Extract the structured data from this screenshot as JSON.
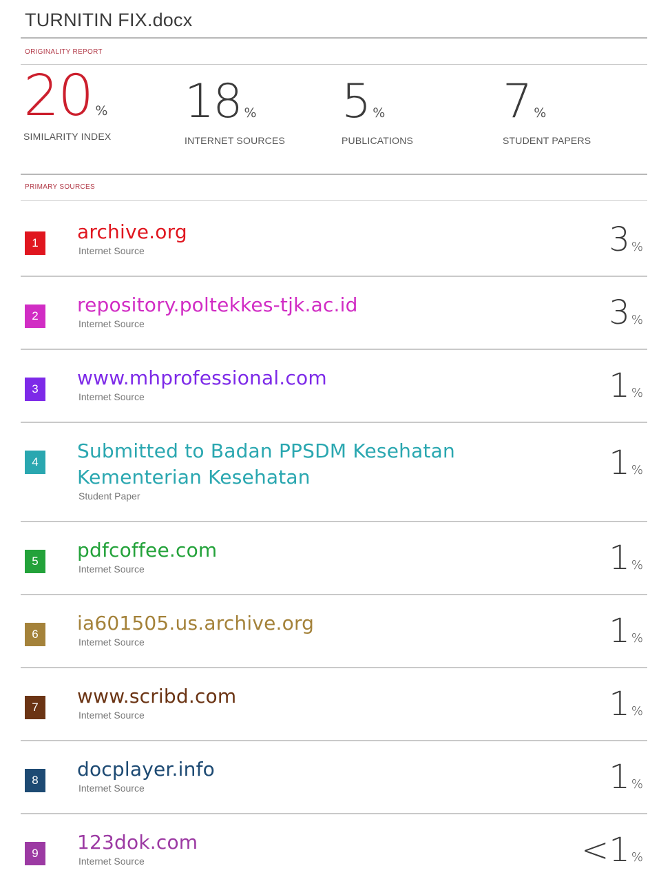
{
  "document": {
    "title": "TURNITIN FIX.docx"
  },
  "originality": {
    "label": "ORIGINALITY REPORT",
    "metrics": [
      {
        "value": "20",
        "unit": "%",
        "label": "SIMILARITY INDEX"
      },
      {
        "value": "18",
        "unit": "%",
        "label": "INTERNET SOURCES"
      },
      {
        "value": "5",
        "unit": "%",
        "label": "PUBLICATIONS"
      },
      {
        "value": "7",
        "unit": "%",
        "label": "STUDENT PAPERS"
      }
    ]
  },
  "primary_sources": {
    "label": "PRIMARY SOURCES",
    "items": [
      {
        "rank": "1",
        "name_lines": [
          "archive.org"
        ],
        "type": "Internet Source",
        "percent": "3",
        "unit": "%",
        "color": "#e0161f"
      },
      {
        "rank": "2",
        "name_lines": [
          "repository.poltekkes-tjk.ac.id"
        ],
        "type": "Internet Source",
        "percent": "3",
        "unit": "%",
        "color": "#d12dc4"
      },
      {
        "rank": "3",
        "name_lines": [
          "www.mhprofessional.com"
        ],
        "type": "Internet Source",
        "percent": "1",
        "unit": "%",
        "color": "#7d2ae8"
      },
      {
        "rank": "4",
        "name_lines": [
          "Submitted to Badan PPSDM Kesehatan",
          "Kementerian Kesehatan"
        ],
        "type": "Student Paper",
        "percent": "1",
        "unit": "%",
        "color": "#2aa7b0"
      },
      {
        "rank": "5",
        "name_lines": [
          "pdfcoffee.com"
        ],
        "type": "Internet Source",
        "percent": "1",
        "unit": "%",
        "color": "#23a23a"
      },
      {
        "rank": "6",
        "name_lines": [
          "ia601505.us.archive.org"
        ],
        "type": "Internet Source",
        "percent": "1",
        "unit": "%",
        "color": "#a4823a"
      },
      {
        "rank": "7",
        "name_lines": [
          "www.scribd.com"
        ],
        "type": "Internet Source",
        "percent": "1",
        "unit": "%",
        "color": "#6b3414"
      },
      {
        "rank": "8",
        "name_lines": [
          "docplayer.info"
        ],
        "type": "Internet Source",
        "percent": "1",
        "unit": "%",
        "color": "#1d4a73"
      },
      {
        "rank": "9",
        "name_lines": [
          "123dok.com"
        ],
        "type": "Internet Source",
        "percent": "<1",
        "unit": "%",
        "color": "#9c3aa3"
      }
    ]
  }
}
